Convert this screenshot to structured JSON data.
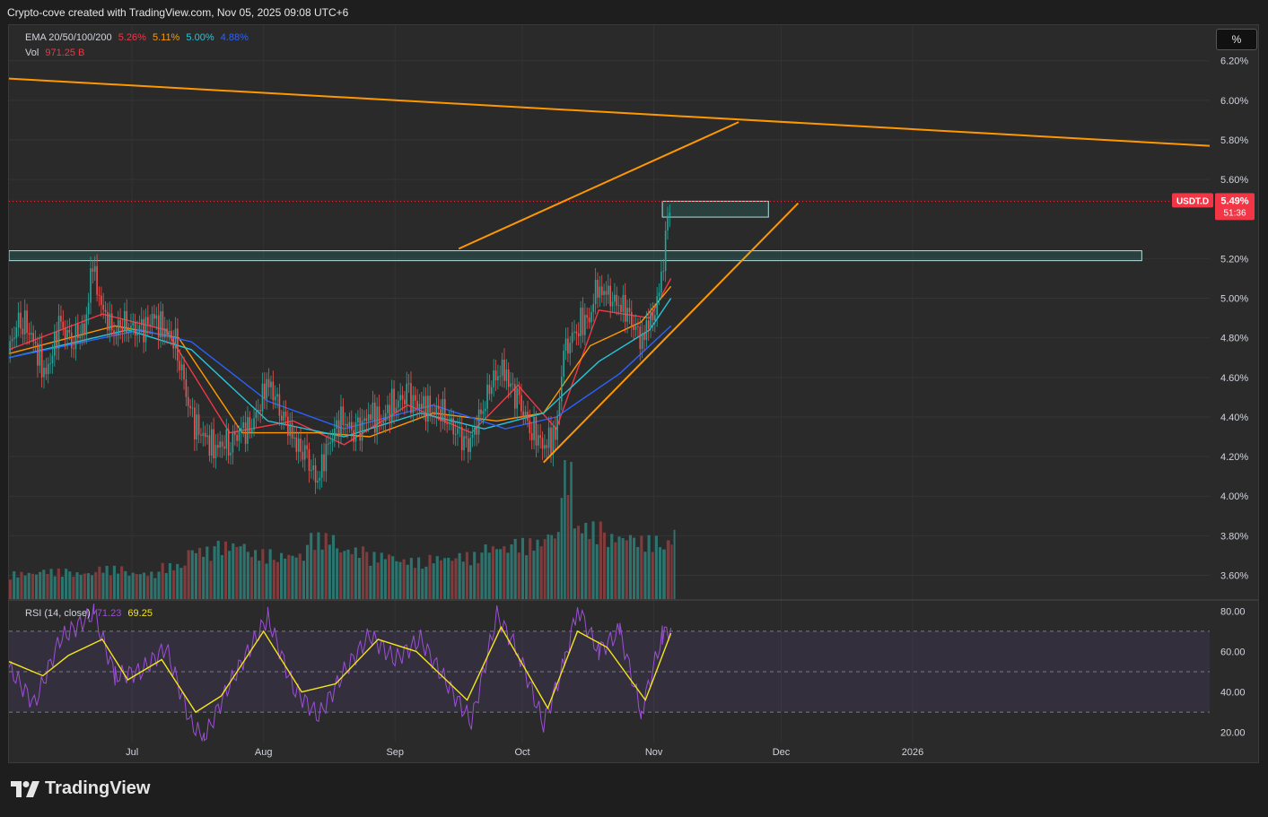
{
  "header": {
    "title": "Crypto-cove created with TradingView.com, Nov 05, 2025 09:08 UTC+6"
  },
  "toolbar": {
    "percent_label": "%"
  },
  "legend": {
    "ema_label": "EMA 20/50/100/200",
    "ema_values": [
      "5.26%",
      "5.11%",
      "5.00%",
      "4.88%"
    ],
    "ema_colors": [
      "#f23645",
      "#ff9800",
      "#26c6da",
      "#2962ff"
    ],
    "vol_label": "Vol",
    "vol_value": "971.25 B"
  },
  "rsi_legend": {
    "label": "RSI (14, close)",
    "value1": "71.23",
    "value2": "69.25"
  },
  "symbol": {
    "name": "USDT.D",
    "price": "5.49%",
    "countdown": "51:36"
  },
  "brand": {
    "name": "TradingView"
  },
  "chart_data": [
    {
      "type": "candlestick",
      "title": "USDT.D",
      "y_tick_labels": [
        "6.20%",
        "6.00%",
        "5.80%",
        "5.60%",
        "5.20%",
        "5.00%",
        "4.80%",
        "4.60%",
        "4.40%",
        "4.20%",
        "4.00%",
        "3.80%",
        "3.60%"
      ],
      "y_ticks": [
        6.2,
        6.0,
        5.8,
        5.6,
        5.2,
        5.0,
        4.8,
        4.6,
        4.4,
        4.2,
        4.0,
        3.8,
        3.6
      ],
      "ylim": [
        3.48,
        6.38
      ],
      "x_tick_labels": [
        "Jul",
        "Aug",
        "Sep",
        "Oct",
        "Nov",
        "Dec",
        "2026"
      ],
      "x_ticks": [
        "2025-07-01",
        "2025-08-01",
        "2025-09-01",
        "2025-10-01",
        "2025-11-01",
        "2025-12-01",
        "2026-01-01"
      ],
      "xlim": [
        "2025-06-02",
        "2026-03-12"
      ],
      "close_series": [
        [
          "2025-06-02",
          4.72
        ],
        [
          "2025-06-05",
          4.92
        ],
        [
          "2025-06-08",
          4.78
        ],
        [
          "2025-06-11",
          4.6
        ],
        [
          "2025-06-14",
          4.86
        ],
        [
          "2025-06-17",
          4.8
        ],
        [
          "2025-06-20",
          4.84
        ],
        [
          "2025-06-22",
          5.18
        ],
        [
          "2025-06-24",
          4.94
        ],
        [
          "2025-06-27",
          4.84
        ],
        [
          "2025-06-30",
          4.88
        ],
        [
          "2025-07-03",
          4.82
        ],
        [
          "2025-07-06",
          4.9
        ],
        [
          "2025-07-09",
          4.84
        ],
        [
          "2025-07-12",
          4.76
        ],
        [
          "2025-07-15",
          4.4
        ],
        [
          "2025-07-18",
          4.3
        ],
        [
          "2025-07-21",
          4.24
        ],
        [
          "2025-07-24",
          4.28
        ],
        [
          "2025-07-27",
          4.32
        ],
        [
          "2025-07-30",
          4.36
        ],
        [
          "2025-08-02",
          4.58
        ],
        [
          "2025-08-05",
          4.46
        ],
        [
          "2025-08-08",
          4.3
        ],
        [
          "2025-08-11",
          4.2
        ],
        [
          "2025-08-14",
          4.08
        ],
        [
          "2025-08-17",
          4.3
        ],
        [
          "2025-08-20",
          4.4
        ],
        [
          "2025-08-23",
          4.3
        ],
        [
          "2025-08-26",
          4.42
        ],
        [
          "2025-08-29",
          4.38
        ],
        [
          "2025-09-01",
          4.48
        ],
        [
          "2025-09-04",
          4.5
        ],
        [
          "2025-09-07",
          4.46
        ],
        [
          "2025-09-10",
          4.44
        ],
        [
          "2025-09-13",
          4.42
        ],
        [
          "2025-09-16",
          4.3
        ],
        [
          "2025-09-19",
          4.26
        ],
        [
          "2025-09-22",
          4.46
        ],
        [
          "2025-09-25",
          4.62
        ],
        [
          "2025-09-27",
          4.64
        ],
        [
          "2025-09-30",
          4.48
        ],
        [
          "2025-10-03",
          4.36
        ],
        [
          "2025-10-06",
          4.26
        ],
        [
          "2025-10-09",
          4.3
        ],
        [
          "2025-10-11",
          4.7
        ],
        [
          "2025-10-14",
          4.86
        ],
        [
          "2025-10-17",
          4.9
        ],
        [
          "2025-10-19",
          5.08
        ],
        [
          "2025-10-21",
          5.0
        ],
        [
          "2025-10-24",
          4.98
        ],
        [
          "2025-10-27",
          4.9
        ],
        [
          "2025-10-29",
          4.8
        ],
        [
          "2025-10-31",
          4.86
        ],
        [
          "2025-11-02",
          4.96
        ],
        [
          "2025-11-03",
          5.1
        ],
        [
          "2025-11-04",
          5.3
        ],
        [
          "2025-11-05",
          5.49
        ]
      ],
      "ema_series": [
        {
          "name": "EMA 20",
          "color": "#f23645",
          "points": [
            [
              "2025-06-02",
              4.74
            ],
            [
              "2025-06-24",
              4.92
            ],
            [
              "2025-07-09",
              4.84
            ],
            [
              "2025-07-24",
              4.32
            ],
            [
              "2025-08-08",
              4.38
            ],
            [
              "2025-08-20",
              4.26
            ],
            [
              "2025-09-04",
              4.46
            ],
            [
              "2025-09-19",
              4.32
            ],
            [
              "2025-09-30",
              4.56
            ],
            [
              "2025-10-09",
              4.34
            ],
            [
              "2025-10-19",
              4.94
            ],
            [
              "2025-10-31",
              4.9
            ],
            [
              "2025-11-05",
              5.1
            ]
          ]
        },
        {
          "name": "EMA 50",
          "color": "#ff9800",
          "points": [
            [
              "2025-06-02",
              4.72
            ],
            [
              "2025-06-27",
              4.86
            ],
            [
              "2025-07-12",
              4.8
            ],
            [
              "2025-07-27",
              4.32
            ],
            [
              "2025-08-14",
              4.32
            ],
            [
              "2025-08-26",
              4.3
            ],
            [
              "2025-09-10",
              4.42
            ],
            [
              "2025-09-25",
              4.38
            ],
            [
              "2025-10-06",
              4.42
            ],
            [
              "2025-10-17",
              4.76
            ],
            [
              "2025-10-29",
              4.88
            ],
            [
              "2025-11-05",
              5.06
            ]
          ]
        },
        {
          "name": "EMA 100",
          "color": "#26c6da",
          "points": [
            [
              "2025-06-02",
              4.7
            ],
            [
              "2025-06-30",
              4.84
            ],
            [
              "2025-07-15",
              4.74
            ],
            [
              "2025-08-02",
              4.38
            ],
            [
              "2025-08-20",
              4.3
            ],
            [
              "2025-09-07",
              4.42
            ],
            [
              "2025-09-22",
              4.34
            ],
            [
              "2025-10-06",
              4.42
            ],
            [
              "2025-10-19",
              4.68
            ],
            [
              "2025-10-31",
              4.84
            ],
            [
              "2025-11-05",
              5.0
            ]
          ]
        },
        {
          "name": "EMA 200",
          "color": "#2962ff",
          "points": [
            [
              "2025-06-02",
              4.7
            ],
            [
              "2025-07-03",
              4.84
            ],
            [
              "2025-07-15",
              4.78
            ],
            [
              "2025-08-02",
              4.48
            ],
            [
              "2025-08-20",
              4.34
            ],
            [
              "2025-09-10",
              4.46
            ],
            [
              "2025-09-27",
              4.34
            ],
            [
              "2025-10-09",
              4.4
            ],
            [
              "2025-10-24",
              4.62
            ],
            [
              "2025-11-05",
              4.86
            ]
          ]
        }
      ],
      "annotations": {
        "current_price_line": 5.49,
        "resistance_zone": {
          "from": [
            "2025-06-02",
            5.19
          ],
          "to": [
            "2026-02-24",
            5.24
          ]
        },
        "breakout_zone": {
          "from": [
            "2025-11-03",
            5.41
          ],
          "to": [
            "2025-11-28",
            5.49
          ]
        },
        "descending_trendline": [
          [
            "2025-06-02",
            6.11
          ],
          [
            "2026-03-12",
            5.77
          ]
        ],
        "wedge_upper": [
          [
            "2025-09-16",
            5.25
          ],
          [
            "2025-11-21",
            5.89
          ]
        ],
        "wedge_lower": [
          [
            "2025-10-06",
            4.17
          ],
          [
            "2025-12-05",
            5.48
          ]
        ]
      }
    },
    {
      "type": "bar",
      "title": "Volume",
      "dates": [
        "2025-06-02",
        "2025-06-09",
        "2025-06-16",
        "2025-06-23",
        "2025-06-30",
        "2025-07-07",
        "2025-07-14",
        "2025-07-21",
        "2025-07-28",
        "2025-08-04",
        "2025-08-11",
        "2025-08-18",
        "2025-08-25",
        "2025-09-01",
        "2025-09-08",
        "2025-09-15",
        "2025-09-22",
        "2025-09-29",
        "2025-10-06",
        "2025-10-10",
        "2025-10-13",
        "2025-10-20",
        "2025-10-27",
        "2025-11-03",
        "2025-11-05"
      ],
      "values": [
        0.2,
        0.22,
        0.2,
        0.24,
        0.2,
        0.26,
        0.38,
        0.42,
        0.36,
        0.34,
        0.48,
        0.38,
        0.34,
        0.3,
        0.32,
        0.34,
        0.4,
        0.44,
        0.5,
        1.0,
        0.56,
        0.48,
        0.46,
        0.44,
        0.5
      ]
    },
    {
      "type": "line",
      "title": "RSI (14, close)",
      "y_tick_labels": [
        "80.00",
        "60.00",
        "40.00",
        "20.00"
      ],
      "y_ticks": [
        80,
        60,
        40,
        20
      ],
      "ylim": [
        15,
        85
      ],
      "bands": [
        70,
        50,
        30
      ],
      "series": [
        {
          "name": "RSI",
          "color": "#9c4fd6",
          "points": [
            [
              "2025-06-02",
              52
            ],
            [
              "2025-06-08",
              34
            ],
            [
              "2025-06-14",
              66
            ],
            [
              "2025-06-22",
              79
            ],
            [
              "2025-06-27",
              48
            ],
            [
              "2025-07-03",
              50
            ],
            [
              "2025-07-09",
              62
            ],
            [
              "2025-07-15",
              24
            ],
            [
              "2025-07-18",
              17
            ],
            [
              "2025-07-24",
              44
            ],
            [
              "2025-08-02",
              77
            ],
            [
              "2025-08-08",
              42
            ],
            [
              "2025-08-14",
              28
            ],
            [
              "2025-08-20",
              50
            ],
            [
              "2025-08-26",
              68
            ],
            [
              "2025-09-01",
              56
            ],
            [
              "2025-09-07",
              66
            ],
            [
              "2025-09-13",
              45
            ],
            [
              "2025-09-19",
              25
            ],
            [
              "2025-09-25",
              78
            ],
            [
              "2025-09-30",
              60
            ],
            [
              "2025-10-06",
              24
            ],
            [
              "2025-10-11",
              55
            ],
            [
              "2025-10-14",
              82
            ],
            [
              "2025-10-19",
              60
            ],
            [
              "2025-10-24",
              70
            ],
            [
              "2025-10-29",
              30
            ],
            [
              "2025-11-03",
              68
            ],
            [
              "2025-11-05",
              71
            ]
          ]
        },
        {
          "name": "RSI MA",
          "color": "#f5e51b",
          "points": [
            [
              "2025-06-02",
              55
            ],
            [
              "2025-06-10",
              48
            ],
            [
              "2025-06-16",
              58
            ],
            [
              "2025-06-24",
              66
            ],
            [
              "2025-06-30",
              46
            ],
            [
              "2025-07-08",
              56
            ],
            [
              "2025-07-16",
              30
            ],
            [
              "2025-07-22",
              38
            ],
            [
              "2025-08-01",
              70
            ],
            [
              "2025-08-10",
              40
            ],
            [
              "2025-08-18",
              44
            ],
            [
              "2025-08-28",
              66
            ],
            [
              "2025-09-06",
              60
            ],
            [
              "2025-09-18",
              36
            ],
            [
              "2025-09-26",
              72
            ],
            [
              "2025-10-07",
              32
            ],
            [
              "2025-10-14",
              70
            ],
            [
              "2025-10-21",
              62
            ],
            [
              "2025-10-30",
              36
            ],
            [
              "2025-11-05",
              69
            ]
          ]
        }
      ]
    }
  ]
}
